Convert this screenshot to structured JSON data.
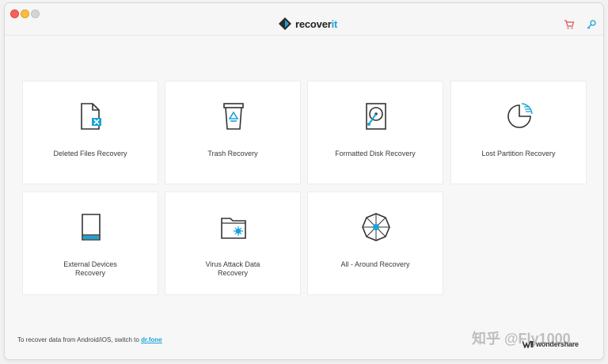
{
  "app": {
    "brand_prefix": "recover",
    "brand_suffix": "it"
  },
  "cards": [
    {
      "label": "Deleted Files Recovery",
      "icon": "deleted-file-icon"
    },
    {
      "label": "Trash Recovery",
      "icon": "trash-icon"
    },
    {
      "label": "Formatted Disk Recovery",
      "icon": "hard-disk-icon"
    },
    {
      "label": "Lost Partition Recovery",
      "icon": "partition-icon"
    },
    {
      "label_line1": "External Devices",
      "label_line2": "Recovery",
      "icon": "external-device-icon"
    },
    {
      "label_line1": "Virus Attack Data",
      "label_line2": "Recovery",
      "icon": "virus-folder-icon"
    },
    {
      "label": "All - Around Recovery",
      "icon": "all-around-icon"
    }
  ],
  "footer": {
    "text": "To recover data from Android/iOS, switch to ",
    "link": "dr.fone"
  },
  "logo": {
    "text": "wondershare"
  },
  "watermark": "知乎 @Fly1000",
  "colors": {
    "accent": "#1aa3d9",
    "icon_stroke": "#333333",
    "card_bg": "#ffffff",
    "window_bg": "#f7f7f7"
  }
}
